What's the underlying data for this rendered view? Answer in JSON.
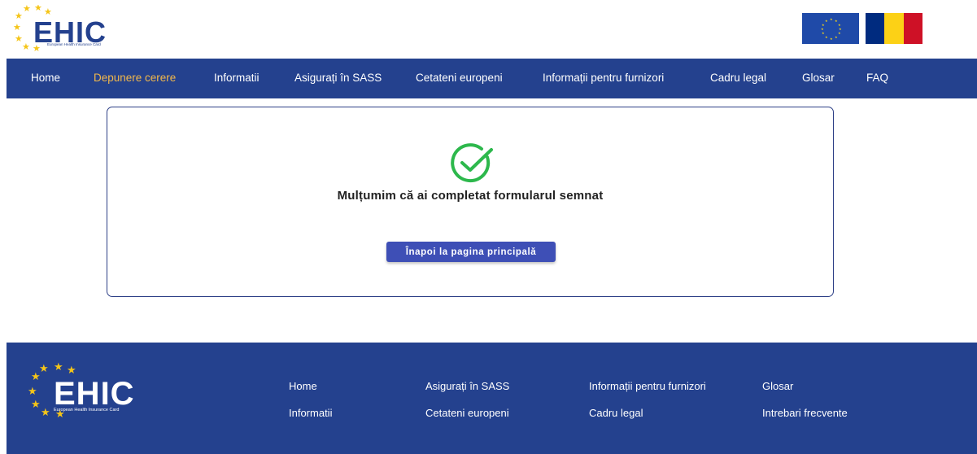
{
  "brand": {
    "logo_text": "EHIC",
    "logo_subtitle": "European Health Insurance Card",
    "star_color": "#f5c518",
    "logo_text_color": "#24418e"
  },
  "flags": {
    "eu": {
      "background": "#1f4aa8",
      "star_color": "#f5d21a"
    },
    "ro": {
      "colors": [
        "#002b7f",
        "#fcd116",
        "#ce1126"
      ]
    }
  },
  "nav": {
    "background": "#24418e",
    "active_color": "#f2b84b",
    "items": [
      {
        "label": "Home",
        "active": false
      },
      {
        "label": "Depunere cerere",
        "active": true
      },
      {
        "label": "Informatii",
        "active": false
      },
      {
        "label": "Asigurați în SASS",
        "active": false
      },
      {
        "label": "Cetateni europeni",
        "active": false
      },
      {
        "label": "Informații pentru furnizori",
        "active": false
      },
      {
        "label": "Cadru legal",
        "active": false
      },
      {
        "label": "Glosar",
        "active": false
      },
      {
        "label": "FAQ",
        "active": false
      }
    ]
  },
  "confirmation": {
    "icon": "check-circle-icon",
    "icon_color": "#2db84c",
    "message": "Mulțumim că ai completat formularul semnat",
    "button_label": "Înapoi la pagina principală",
    "button_color": "#3e4fb6"
  },
  "footer": {
    "background": "#24418e",
    "logo_text": "EHIC",
    "logo_subtitle": "European Health Insurance Card",
    "links": [
      {
        "label": "Home"
      },
      {
        "label": "Informatii"
      },
      {
        "label": "Asigurați în SASS"
      },
      {
        "label": "Cetateni europeni"
      },
      {
        "label": "Informații pentru furnizori"
      },
      {
        "label": "Cadru legal"
      },
      {
        "label": "Glosar"
      },
      {
        "label": "Intrebari frecvente"
      }
    ]
  }
}
